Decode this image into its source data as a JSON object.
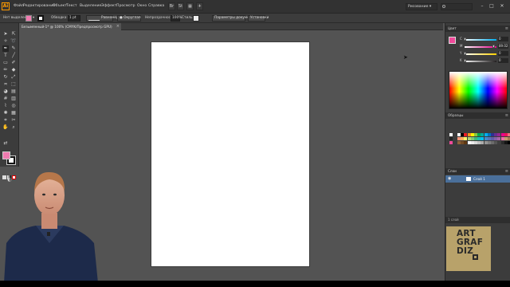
{
  "menu": {
    "logo": "Ai",
    "items": [
      "Файл",
      "Редактирование",
      "Объект",
      "Текст",
      "Выделение",
      "Эффект",
      "Просмотр",
      "Окно",
      "Справка"
    ],
    "workspace": "Рисование",
    "search_placeholder": "",
    "window_controls": [
      "–",
      "□",
      "✕"
    ]
  },
  "control": {
    "selection_label": "Нет выделения",
    "stroke_label": "Обводка:",
    "stroke_value": "1 pt",
    "uniform_label": "Равномерно",
    "style_label": "Округлая",
    "opacity_label": "Непрозрачность:",
    "opacity_value": "100%",
    "style2_label": "Стиль:",
    "doc_setup": "Параметры документа",
    "prefs": "Установки"
  },
  "document": {
    "tab_title": "Безымянный-1* @ 100% (CMYK/Предпросмотр GPU)",
    "close": "×"
  },
  "panels": {
    "color_title": "Цвет",
    "channels": [
      {
        "ch": "C",
        "val": "0",
        "pos": 0.0,
        "color": "#00aeef"
      },
      {
        "ch": "M",
        "val": "89.02",
        "pos": 0.89,
        "color": "#ec008c"
      },
      {
        "ch": "Y",
        "val": "0",
        "pos": 0.0,
        "color": "#ffd200"
      },
      {
        "ch": "K",
        "val": "0",
        "pos": 0.0,
        "color": "#231f20"
      }
    ],
    "swatches_title": "Образцы",
    "layers_title": "Слои",
    "layer_name": "Слой 1",
    "layers_count": "1 слой"
  },
  "branding": {
    "logo_lines": [
      "ART",
      "GRAF",
      "DIZ"
    ]
  },
  "colors": {
    "accent_fill": "#f04a9a",
    "canvas_bg": "#535353"
  }
}
